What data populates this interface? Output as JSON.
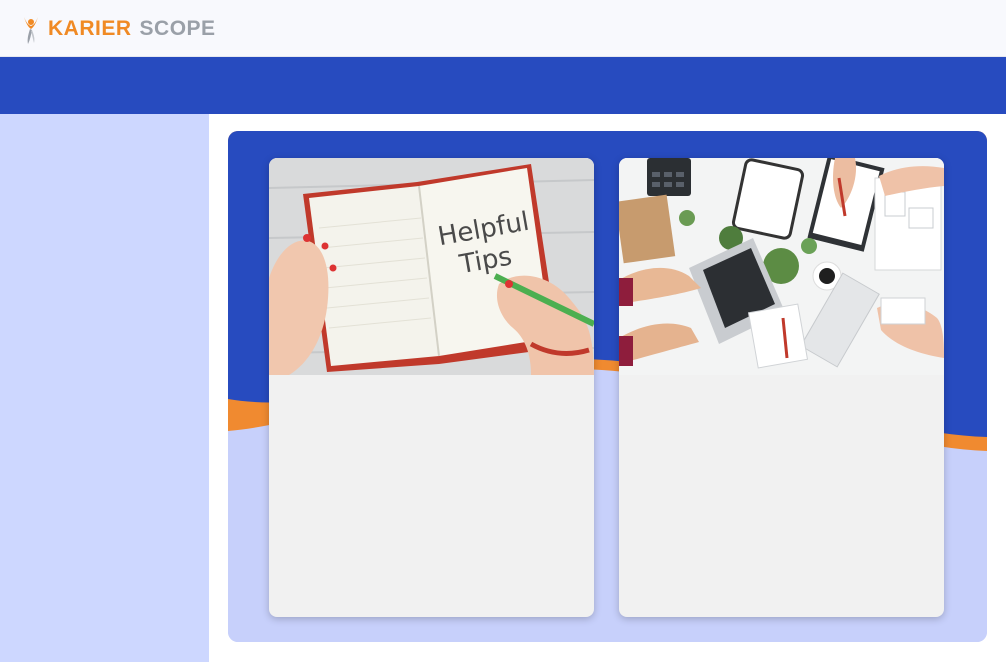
{
  "brand": {
    "name_part1": "KARIER",
    "name_part2": "SCOPE",
    "colors": {
      "orange": "#f08a24",
      "gray": "#9aa0a8",
      "blue": "#274bbf"
    }
  },
  "cards": [
    {
      "image_text_line1": "Helpful",
      "image_text_line2": "Tips"
    },
    {}
  ]
}
